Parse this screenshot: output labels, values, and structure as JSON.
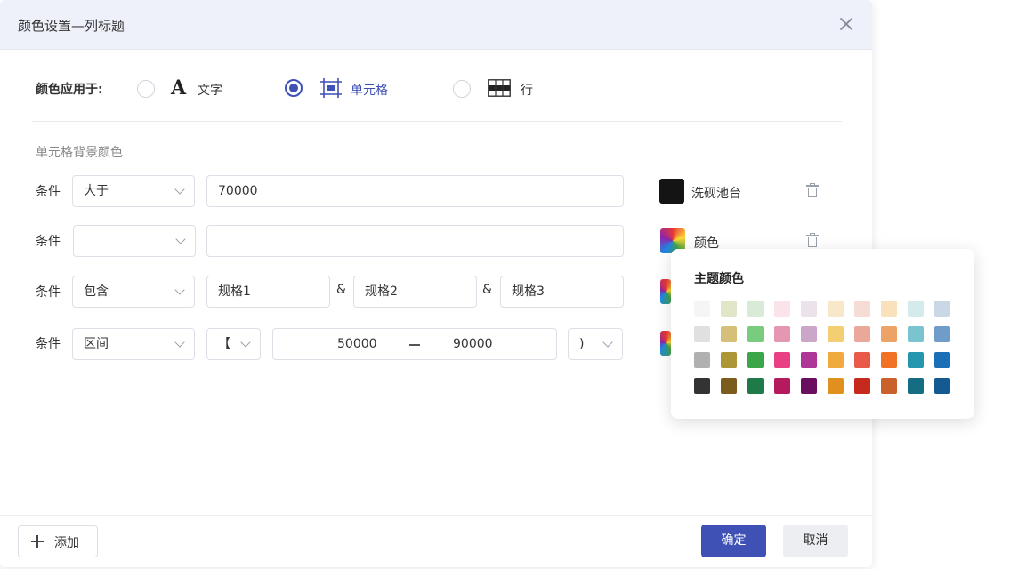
{
  "dialog": {
    "title": "颜色设置—列标题"
  },
  "apply": {
    "label": "颜色应用于:",
    "options": [
      {
        "label": "文字",
        "icon": "letter-a-icon",
        "selected": false
      },
      {
        "label": "单元格",
        "icon": "cell-icon",
        "selected": true
      },
      {
        "label": "行",
        "icon": "row-icon",
        "selected": false
      }
    ]
  },
  "section": {
    "label": "单元格背景颜色"
  },
  "conditions": [
    {
      "label": "条件",
      "operator": "大于",
      "value": "70000",
      "color_name": "洗砚池台",
      "color_icon": "black-swatch"
    },
    {
      "label": "条件",
      "operator": "",
      "value": "",
      "color_name": "颜色",
      "color_icon": "rainbow-swatch"
    },
    {
      "label": "条件",
      "operator": "包含",
      "values": [
        "规格1",
        "规格2",
        "规格3"
      ],
      "joiner": "&",
      "color_icon": "rainbow-swatch"
    },
    {
      "label": "条件",
      "operator": "区间",
      "left_bracket": "【",
      "from": "50000",
      "to": "90000",
      "right_bracket": ")",
      "color_icon": "rainbow-swatch"
    }
  ],
  "footer": {
    "add_label": "添加",
    "ok_label": "确定",
    "cancel_label": "取消"
  },
  "colors": {
    "accent": "#3f51b5",
    "black_swatch": "#141414"
  },
  "palette": {
    "title": "主题颜色",
    "rows": [
      [
        "#f5f5f5",
        "#e2e6c8",
        "#d8ead8",
        "#fae4ea",
        "#ece2ea",
        "#f6e8c9",
        "#f5dcd4",
        "#f8e1bb",
        "#d4ebee",
        "#c9d7e6"
      ],
      [
        "#e0e0e0",
        "#d6c079",
        "#79cc7e",
        "#e596b3",
        "#cba6c8",
        "#f3cf71",
        "#eaa89b",
        "#eda365",
        "#79c4cf",
        "#6f9cc9"
      ],
      [
        "#b0b0b0",
        "#ad9636",
        "#3aa64a",
        "#e83f85",
        "#ae3697",
        "#f0ab3f",
        "#ea5a48",
        "#f37125",
        "#2496ad",
        "#1a6fb6"
      ],
      [
        "#333333",
        "#7a5d1d",
        "#1e7a48",
        "#b51a5e",
        "#6a0f5f",
        "#e0901e",
        "#c62a1c",
        "#c8622a",
        "#146d82",
        "#135a90"
      ]
    ]
  }
}
